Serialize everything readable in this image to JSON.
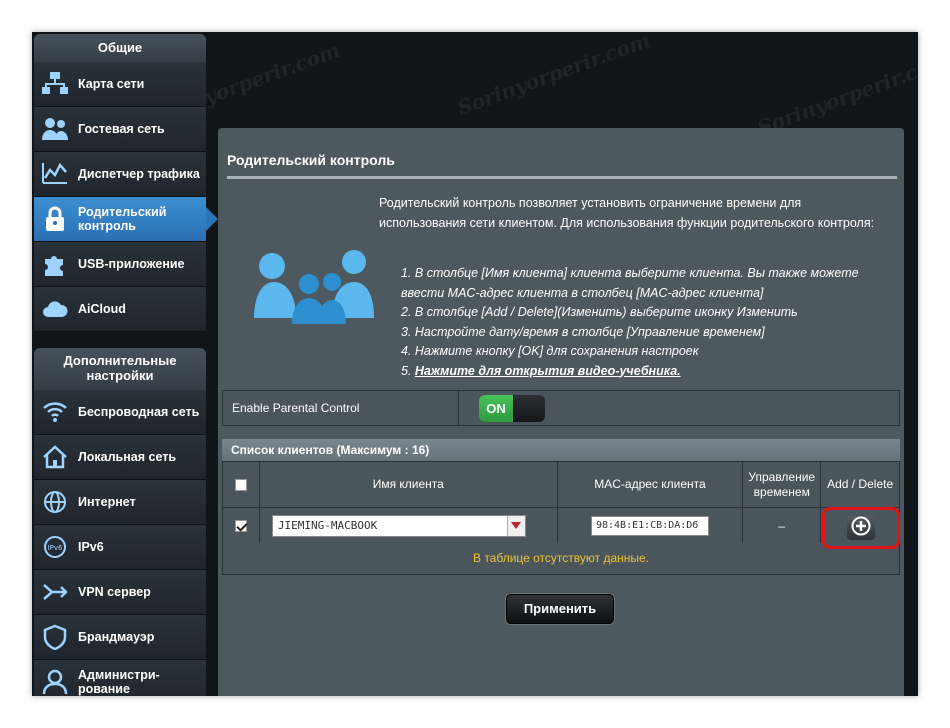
{
  "sidebar": {
    "general_title": "Общие",
    "general_items": [
      {
        "label": "Карта сети",
        "icon": "network-map-icon"
      },
      {
        "label": "Гостевая сеть",
        "icon": "guest-network-icon"
      },
      {
        "label": "Диспетчер трафика",
        "icon": "traffic-manager-icon"
      },
      {
        "label": "Родительский контроль",
        "icon": "parental-control-icon",
        "active": true
      },
      {
        "label": "USB-приложение",
        "icon": "usb-puzzle-icon"
      },
      {
        "label": "AiCloud",
        "icon": "cloud-icon"
      }
    ],
    "advanced_title": "Дополнительные настройки",
    "advanced_items": [
      {
        "label": "Беспроводная сеть",
        "icon": "wireless-icon"
      },
      {
        "label": "Локальная сеть",
        "icon": "lan-home-icon"
      },
      {
        "label": "Интернет",
        "icon": "globe-icon"
      },
      {
        "label": "IPv6",
        "icon": "ipv6-icon"
      },
      {
        "label": "VPN сервер",
        "icon": "vpn-icon"
      },
      {
        "label": "Брандмауэр",
        "icon": "firewall-shield-icon"
      },
      {
        "label": "Администри-рование",
        "icon": "admin-user-icon"
      }
    ]
  },
  "main": {
    "title": "Родительский контроль",
    "description": "Родительский контроль позволяет установить ограничение времени для использования сети клиентом. Для использования функции родительского контроля:",
    "steps": [
      "1. В столбце [Имя клиента] клиента выберите клиента. Вы также можете ввести MAC-адрес клиента в столбец [MAC-адрес клиента]",
      "2. В столбце [Add / Delete](Изменить) выберите иконку Изменить",
      "3. Настройте дату/время в столбце [Управление временем]",
      "4. Нажмите кнопку [OK] для сохранения настроек"
    ],
    "step5_prefix": "5. ",
    "step5_link": "Нажмите для открытия видео-учебника.",
    "enable_label": "Enable Parental Control",
    "toggle_on": "ON",
    "list_title": "Список клиентов (Максимум : 16)",
    "columns": {
      "client_name": "Имя клиента",
      "mac": "MAC-адрес клиента",
      "time_mgmt": "Управление временем",
      "add_delete": "Add / Delete"
    },
    "row": {
      "checked": true,
      "client_name": "JIEMING-MACBOOK",
      "mac": "98:4B:E1:CB:DA:D6",
      "time_mgmt": "–"
    },
    "no_data": "В таблице отсутствуют данные.",
    "apply": "Применить"
  },
  "watermark": "Sorinyorperir.com",
  "colors": {
    "accent": "#2a6fb3",
    "toggle_on": "#3bb04d",
    "highlight": "#e01414",
    "no_data": "#f1c232"
  }
}
